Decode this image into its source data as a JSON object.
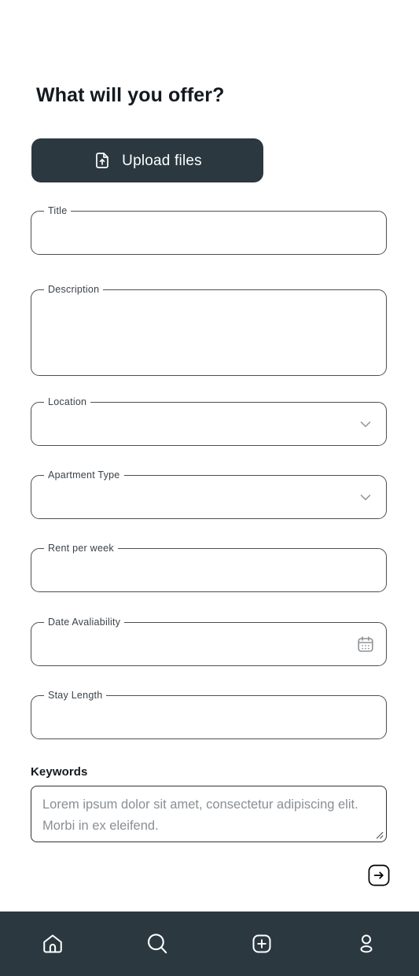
{
  "page": {
    "title": "What will you offer?",
    "background_color": "#ffffff",
    "accent_dark": "#2b3840",
    "text_color": "#13191f"
  },
  "upload": {
    "label": "Upload files",
    "icon": "file-upload-icon",
    "background_color": "#2b3840",
    "text_color": "#ffffff"
  },
  "form": {
    "fields": [
      {
        "label": "Title",
        "value": "",
        "placeholder": "",
        "type": "text",
        "icon": null
      },
      {
        "label": "Description",
        "value": "",
        "placeholder": "",
        "type": "textarea",
        "icon": null
      },
      {
        "label": "Location",
        "value": "",
        "placeholder": "",
        "type": "select",
        "icon": "chevron-down-icon"
      },
      {
        "label": "Apartment Type",
        "value": "",
        "placeholder": "",
        "type": "select",
        "icon": "chevron-down-icon"
      },
      {
        "label": "Rent per week",
        "value": "",
        "placeholder": "",
        "type": "text",
        "icon": null
      },
      {
        "label": "Date Avaliability",
        "value": "",
        "placeholder": "",
        "type": "date",
        "icon": "calendar-icon"
      },
      {
        "label": "Stay Length",
        "value": "",
        "placeholder": "",
        "type": "text",
        "icon": null
      }
    ]
  },
  "keywords": {
    "label": "Keywords",
    "value": "",
    "placeholder": "Lorem ipsum dolor sit amet, consectetur adipiscing elit. Morbi in ex eleifend.",
    "resize_handle": "resize-handle-icon"
  },
  "submit": {
    "icon": "arrow-right-icon",
    "label": ""
  },
  "bottom_nav": {
    "background_color": "#2b3840",
    "items": [
      {
        "name": "home",
        "icon": "home-icon"
      },
      {
        "name": "search",
        "icon": "search-icon"
      },
      {
        "name": "add",
        "icon": "plus-square-icon"
      },
      {
        "name": "profile",
        "icon": "person-icon"
      }
    ]
  }
}
